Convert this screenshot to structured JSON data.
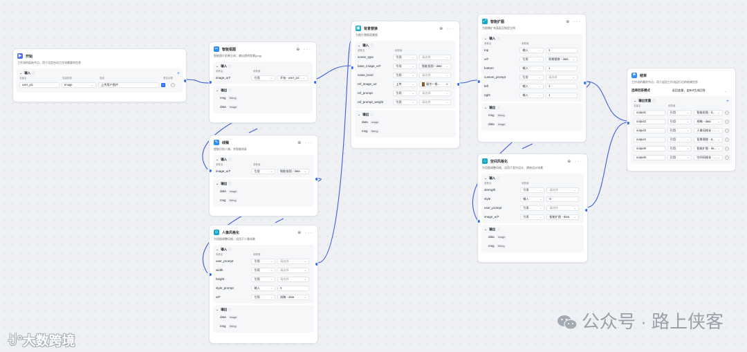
{
  "nodes": {
    "start": {
      "title": "开始",
      "desc": "工作流的起始节点，用于设定启动工作流需要的信息",
      "inputs_label": "输入",
      "col_name": "变量名",
      "col_type": "变量类型",
      "col_desc": "描述",
      "col_required": "是否必要",
      "var_name": "user_pic",
      "var_type": "Image",
      "var_desc": "上传用户图片"
    },
    "cutout": {
      "title": "智能抠图",
      "desc": "智能图片前景主体，输出透明背景(png)",
      "inputs_label": "输入",
      "col_param": "参数名",
      "col_value": "参数值",
      "rows": [
        {
          "name": "image_url*",
          "mode": "引用",
          "value": "开始 - user_pic"
        }
      ],
      "outputs_label": "输出",
      "outputs": [
        {
          "name": "msg",
          "type": "String"
        },
        {
          "name": "data",
          "type": "Image"
        }
      ]
    },
    "sketch": {
      "title": "线稿",
      "desc": "提取识别人像，并智能线条",
      "inputs_label": "输入",
      "col_param": "参数名",
      "col_value": "参数值",
      "rows": [
        {
          "name": "image_url*",
          "mode": "引用",
          "value": "智能抠图 - data"
        }
      ],
      "outputs_label": "输出",
      "outputs": [
        {
          "name": "data",
          "type": "Image"
        },
        {
          "name": "msg",
          "type": "String"
        }
      ]
    },
    "portrait": {
      "title": "人像风格化",
      "desc": "为用图调整风格，适用于人像场景",
      "inputs_label": "输入",
      "col_param": "参数名",
      "col_value": "参数值",
      "rows": [
        {
          "name": "user_prompt",
          "mode": "引用",
          "value": "请选择"
        },
        {
          "name": "width",
          "mode": "引用",
          "value": "请选择"
        },
        {
          "name": "height",
          "mode": "引用",
          "value": "请选择"
        },
        {
          "name": "style_prompt",
          "mode": "输入",
          "value": "3"
        },
        {
          "name": "url*",
          "mode": "引用",
          "value": "线稿 - data"
        }
      ],
      "outputs_label": "输出",
      "outputs": [
        {
          "name": "data",
          "type": "Image"
        },
        {
          "name": "msg",
          "type": "String"
        }
      ]
    },
    "bgreplace": {
      "title": "背景替换",
      "desc": "为图片替换背景图",
      "inputs_label": "输入",
      "col_param": "参数名",
      "col_value": "参数值",
      "rows": [
        {
          "name": "scene_type",
          "mode": "引用",
          "value": "请选择"
        },
        {
          "name": "base_image_url*",
          "mode": "引用",
          "value": "智能抠图 - data"
        },
        {
          "name": "noise_level",
          "mode": "引用",
          "value": "请选择"
        },
        {
          "name": "ref_image_url",
          "mode": "上传",
          "value": "福字一角..."
        },
        {
          "name": "ref_prompt",
          "mode": "引用",
          "value": "请选择"
        },
        {
          "name": "ref_prompt_weight",
          "mode": "引用",
          "value": "请选择"
        }
      ],
      "outputs_label": "输出",
      "outputs": [
        {
          "name": "data",
          "type": "Image"
        },
        {
          "name": "msg",
          "type": "String"
        }
      ]
    },
    "expand": {
      "title": "智能扩图",
      "desc": "为图像扩充画面至指定比例",
      "inputs_label": "输入",
      "col_param": "参数名",
      "col_value": "参数值",
      "rows": [
        {
          "name": "top",
          "mode": "输入",
          "value": "1"
        },
        {
          "name": "url*",
          "mode": "引用",
          "value": "背景替换 - data"
        },
        {
          "name": "bottom",
          "mode": "输入",
          "value": "1"
        },
        {
          "name": "custom_prompt",
          "mode": "引用",
          "value": "请选择"
        },
        {
          "name": "left",
          "mode": "输入",
          "value": "1"
        },
        {
          "name": "right",
          "mode": "输入",
          "value": "1"
        }
      ],
      "outputs_label": "输出",
      "outputs": [
        {
          "name": "msg",
          "type": "String"
        },
        {
          "name": "data",
          "type": "Image"
        }
      ]
    },
    "spatial": {
      "title": "空间风格化",
      "desc": "为用图调整风格，适用于室内设计、建筑设计场景",
      "inputs_label": "输入",
      "col_param": "参数名",
      "col_value": "参数值",
      "rows": [
        {
          "name": "strength",
          "mode": "引用",
          "value": "请选择"
        },
        {
          "name": "style",
          "mode": "输入",
          "value": "5"
        },
        {
          "name": "user_prompt",
          "mode": "引用",
          "value": "请选择"
        },
        {
          "name": "image_url*",
          "mode": "引用",
          "value": "智能扩图 - data"
        }
      ],
      "outputs_label": "输出",
      "outputs": [
        {
          "name": "data",
          "type": "Image"
        },
        {
          "name": "msg",
          "type": "String"
        }
      ]
    },
    "end": {
      "title": "结束",
      "desc": "工作流的最终节点，用于返回工作流运行后的结果信息",
      "mode_label": "选择回答模式",
      "mode_value": "返回变量，由Bot生成回答",
      "outputs_label": "输出变量",
      "col_name": "变量名",
      "col_value": "参数值",
      "rows": [
        {
          "name": "output1",
          "mode": "引用",
          "value": "智能抠图 - d..."
        },
        {
          "name": "output2",
          "mode": "引用",
          "value": "线稿 - data"
        },
        {
          "name": "output3",
          "mode": "引用",
          "value": "人像风格化 - ..."
        },
        {
          "name": "output4",
          "mode": "引用",
          "value": "背景替换 - d..."
        },
        {
          "name": "output5",
          "mode": "引用",
          "value": "智能扩图 - da..."
        },
        {
          "name": "output6",
          "mode": "引用",
          "value": "空间风格化 - ..."
        }
      ]
    }
  },
  "watermarks": {
    "wechat": "公众号 · 路上侠客",
    "brand": "大数跨境"
  },
  "colors": {
    "accent": "#3370ff",
    "start": "#4e6ef2",
    "tool": "#2f8cf4",
    "image": "#14a8c8",
    "end": "#2f8cf4"
  }
}
